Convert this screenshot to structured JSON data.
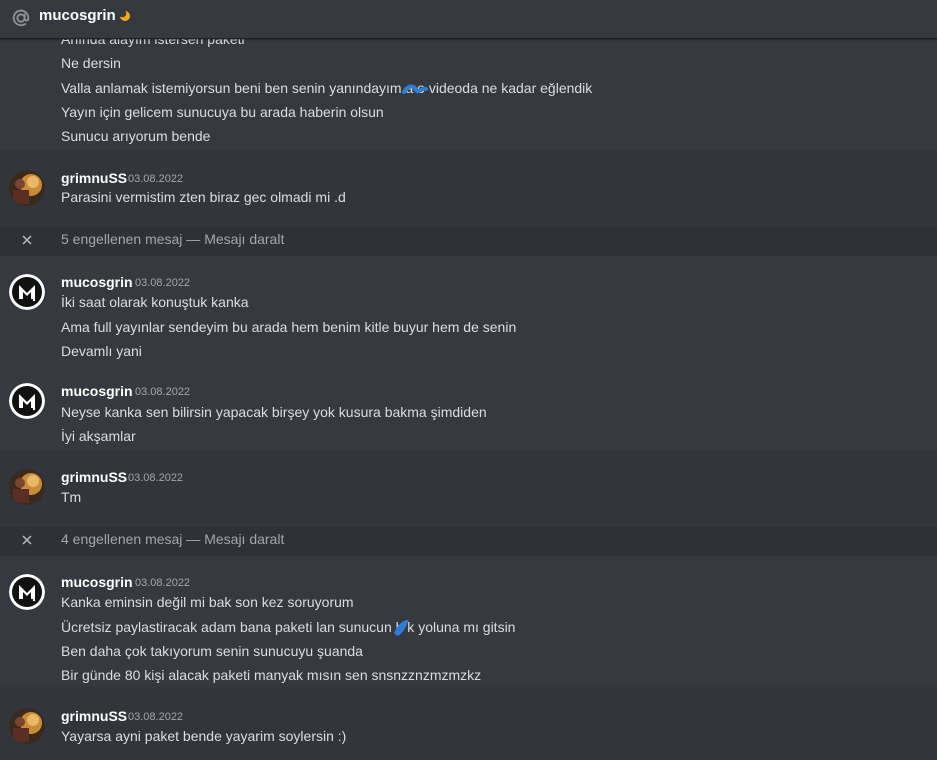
{
  "header": {
    "channel_name": "mucosgrin",
    "at_icon": "at-sign-icon",
    "status_icon": "moon-idle-icon",
    "status_color": "#faa81a"
  },
  "colors": {
    "background": "#36393f",
    "hover_band": "#32353b",
    "text": "#dcddde",
    "username": "#ffffff",
    "muted": "#a3a6aa"
  },
  "messages": [
    {
      "continuation": true,
      "lines": [
        "Anında alayım istersen paketi",
        "Ne dersin",
        "Valla anlamak istemiyorsun beni ben senin yanındayım a  o videoda ne kadar eğlendik",
        "Yayın için gelicem sunucuya bu arada haberin olsun",
        "Sunucu arıyorum bende"
      ]
    },
    {
      "author": "grimnuSS",
      "date": "03.08.2022",
      "avatar": "grimnuss-avatar",
      "lines": [
        "Parasini vermistim zten biraz gec olmadi mi .d"
      ]
    },
    {
      "blocked": true,
      "text": "5 engellenen mesaj — ",
      "action": "Mesajı daralt"
    },
    {
      "author": "mucosgrin",
      "date": "03.08.2022",
      "avatar": "mucosgrin-m-logo-avatar",
      "lines": [
        "İki saat olarak konuştuk kanka",
        "Ama full yayınlar sendeyim bu arada hem benim kitle buyur hem de senin",
        "Devamlı yani"
      ]
    },
    {
      "author": "mucosgrin",
      "date": "03.08.2022",
      "avatar": "mucosgrin-m-logo-avatar",
      "lines": [
        "Neyse kanka sen bilirsin yapacak birşey yok kusura bakma şimdiden",
        "İyi akşamlar"
      ]
    },
    {
      "author": "grimnuSS",
      "date": "03.08.2022",
      "avatar": "grimnuss-avatar",
      "lines": [
        "Tm"
      ]
    },
    {
      "blocked": true,
      "text": "4 engellenen mesaj — ",
      "action": "Mesajı daralt"
    },
    {
      "author": "mucosgrin",
      "date": "03.08.2022",
      "avatar": "mucosgrin-m-logo-avatar",
      "lines": [
        "Kanka eminsin değil mi bak son kez soruyorum",
        "Ücretsiz paylastiracak adam bana paketi lan sunucun b  k yoluna mı gitsin",
        "Ben daha çok takıyorum senin sunucuyu şuanda",
        "Bir günde 80 kişi alacak paketi manyak mısın sen snsnzznzmzmzkz"
      ]
    },
    {
      "author": "grimnuSS",
      "date": "03.08.2022",
      "avatar": "grimnuss-avatar",
      "lines": [
        "Yayarsa ayni paket bende yayarim soylersin :)"
      ]
    }
  ]
}
